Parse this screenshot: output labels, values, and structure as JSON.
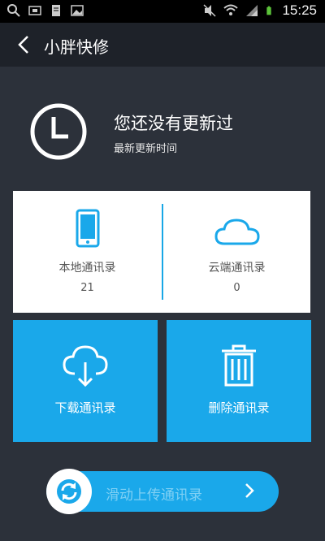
{
  "status_bar": {
    "time": "15:25",
    "icons": [
      "search-icon",
      "box-icon",
      "file-icon",
      "image-icon",
      "mute-icon",
      "wifi-icon",
      "signal-icon",
      "battery-icon"
    ]
  },
  "title_bar": {
    "title": "小胖快修",
    "back_icon": "chevron-left-icon"
  },
  "header": {
    "main": "您还没有更新过",
    "sub": "最新更新时间",
    "icon": "clock-icon"
  },
  "contacts": {
    "local": {
      "label": "本地通讯录",
      "count": "21",
      "icon": "phone-icon"
    },
    "cloud": {
      "label": "云端通讯录",
      "count": "0",
      "icon": "cloud-icon"
    }
  },
  "actions": {
    "download": {
      "label": "下载通讯录",
      "icon": "cloud-download-icon"
    },
    "delete": {
      "label": "删除通讯录",
      "icon": "trash-icon"
    }
  },
  "slider": {
    "label": "滑动上传通讯录",
    "icon": "sync-icon"
  },
  "colors": {
    "accent": "#1aa8ea",
    "background": "#2c313a",
    "titlebar": "#1e2229"
  }
}
